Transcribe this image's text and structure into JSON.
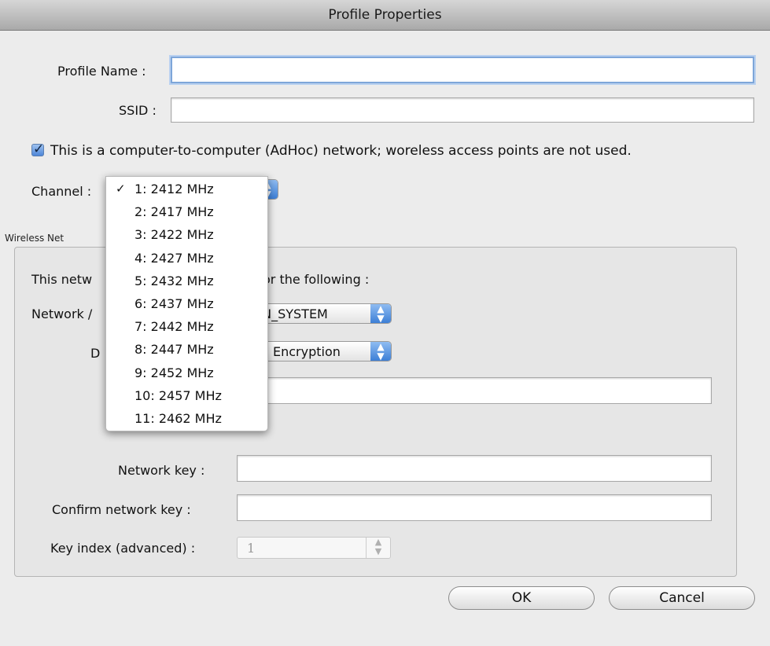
{
  "window": {
    "title": "Profile Properties"
  },
  "form": {
    "profile_name_label": "Profile Name :",
    "profile_name_value": "",
    "ssid_label": "SSID :",
    "ssid_value": "",
    "adhoc_checked": true,
    "adhoc_label": "This is a computer-to-computer (AdHoc) network; woreless access points are not used.",
    "channel_label": "Channel :"
  },
  "group": {
    "label": "Wireless Net",
    "intro_visible": "This netw",
    "intro_right": "or the following :",
    "network_auth_label_visible": "Network /",
    "network_auth_value_visible": "EN_SYSTEM",
    "data_enc_label_visible": "D",
    "data_enc_value_visible": "Encryption",
    "network_key_label": "Network key :",
    "confirm_key_label": "Confirm network key :",
    "key_index_label": "Key index (advanced) :",
    "key_index_value": "1"
  },
  "buttons": {
    "ok": "OK",
    "cancel": "Cancel"
  },
  "channel_menu": {
    "selected_index": 0,
    "check_glyph": "✓",
    "items": [
      "1: 2412 MHz",
      "2: 2417 MHz",
      "3: 2422 MHz",
      "4: 2427 MHz",
      "5: 2432 MHz",
      "6: 2437 MHz",
      "7: 2442 MHz",
      "8: 2447 MHz",
      "9: 2452 MHz",
      "10: 2457 MHz",
      "11: 2462 MHz"
    ]
  },
  "icons": {
    "popup_arrows": "updown-arrows-icon",
    "checkmark": "checkmark-icon"
  },
  "colors": {
    "accent": "#4d86d8",
    "focus_ring": "#7ea6d9"
  }
}
